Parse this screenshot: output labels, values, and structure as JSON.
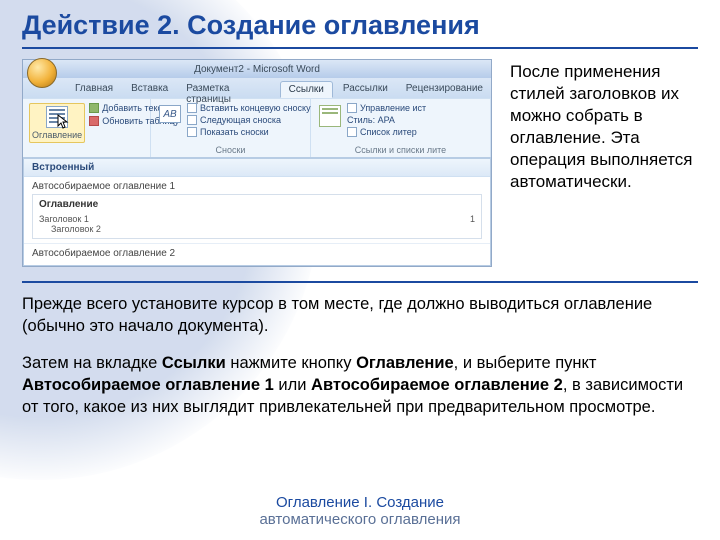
{
  "title": "Действие 2. Создание оглавления",
  "caption": "После применения стилей заголовков их можно собрать в оглавление. Эта операция выполняется автоматически.",
  "word": {
    "window_title": "Документ2 - Microsoft Word",
    "tabs": [
      "Главная",
      "Вставка",
      "Разметка страницы",
      "Ссылки",
      "Рассылки",
      "Рецензирование"
    ],
    "active_tab_index": 3,
    "toc_button": "Оглавление",
    "add_text": "Добавить текст",
    "update": "Обновить таблицу",
    "ab": "AB",
    "insert_endnote": "Вставить концевую сноску",
    "next_footnote": "Следующая сноска",
    "show_notes": "Показать сноски",
    "manage_sources": "Управление ист",
    "style_label": "Стиль: APA",
    "bibliography": "Список литер",
    "group_footnotes": "Сноски",
    "group_citations": "Ссылки и списки лите",
    "gallery_header": "Встроенный",
    "items": [
      {
        "label": "Автособираемое оглавление 1",
        "heading": "Оглавление",
        "rows": [
          {
            "left": "Заголовок 1",
            "right": "1"
          },
          {
            "left": "Заголовок 2",
            "right": ""
          }
        ]
      },
      {
        "label": "Автособираемое оглавление 2",
        "heading": "",
        "rows": []
      }
    ]
  },
  "para1": "Прежде всего установите курсор в том месте, где должно выводиться оглавление (обычно это начало документа).",
  "para2_a": "Затем на вкладке ",
  "para2_b": "Ссылки",
  "para2_c": " нажмите кнопку ",
  "para2_d": "Оглавление",
  "para2_e": ", и выберите пункт ",
  "para2_f": "Автособираемое оглавление 1",
  "para2_g": " или ",
  "para2_h": "Автособираемое оглавление 2",
  "para2_i": ", в зависимости от того, какое из них выглядит привлекательней при предварительном просмотре.",
  "footer_line1": "Оглавление I. Создание",
  "footer_line2": "автоматического оглавления"
}
